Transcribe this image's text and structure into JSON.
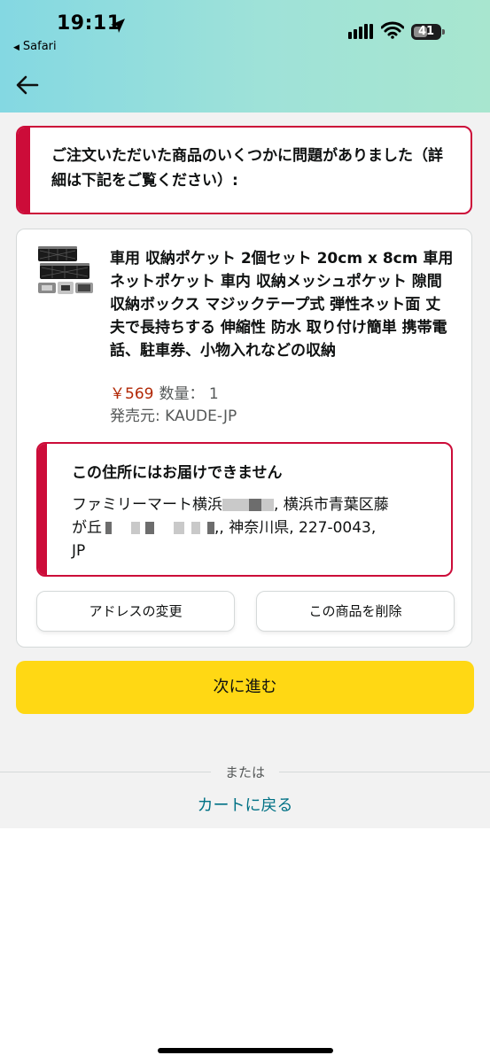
{
  "status_bar": {
    "time": "19:11",
    "back_app": "Safari",
    "battery": "41"
  },
  "alert": {
    "message": "ご注文いただいた商品のいくつかに問題がありました（詳細は下記をご覧ください）:"
  },
  "item": {
    "name": "車用 収納ポケット 2個セット 20cm x 8cm 車用 ネットポケット 車内 収納メッシュポケット 隙間収納ボックス マジックテープ式 弾性ネット面 丈夫で長持ちする 伸縮性 防水 取り付け簡単 携帯電話、駐車券、小物入れなどの収納",
    "price": "￥569",
    "quantity_label": "数量：  1",
    "seller": "発売元: KAUDE-JP"
  },
  "address_warning": {
    "title": "この住所にはお届けできません",
    "line1_start": "ファミリーマート横浜",
    "line1_end": ", 横浜市青葉区藤",
    "line2_start": "が丘",
    "line2_end": ",, 神奈川県, 227-0043,",
    "line3": "JP"
  },
  "buttons": {
    "change_address": "アドレスの変更",
    "delete_item": "この商品を削除",
    "next": "次に進む"
  },
  "footer": {
    "or_text": "または",
    "back_to_cart": "カートに戻る"
  },
  "colors": {
    "header_gradient": [
      "#84d8e2",
      "#a8e6cf"
    ],
    "alert": "#cc0c39",
    "primary_button": "#ffd814",
    "price": "#b12704",
    "link": "#007185"
  }
}
